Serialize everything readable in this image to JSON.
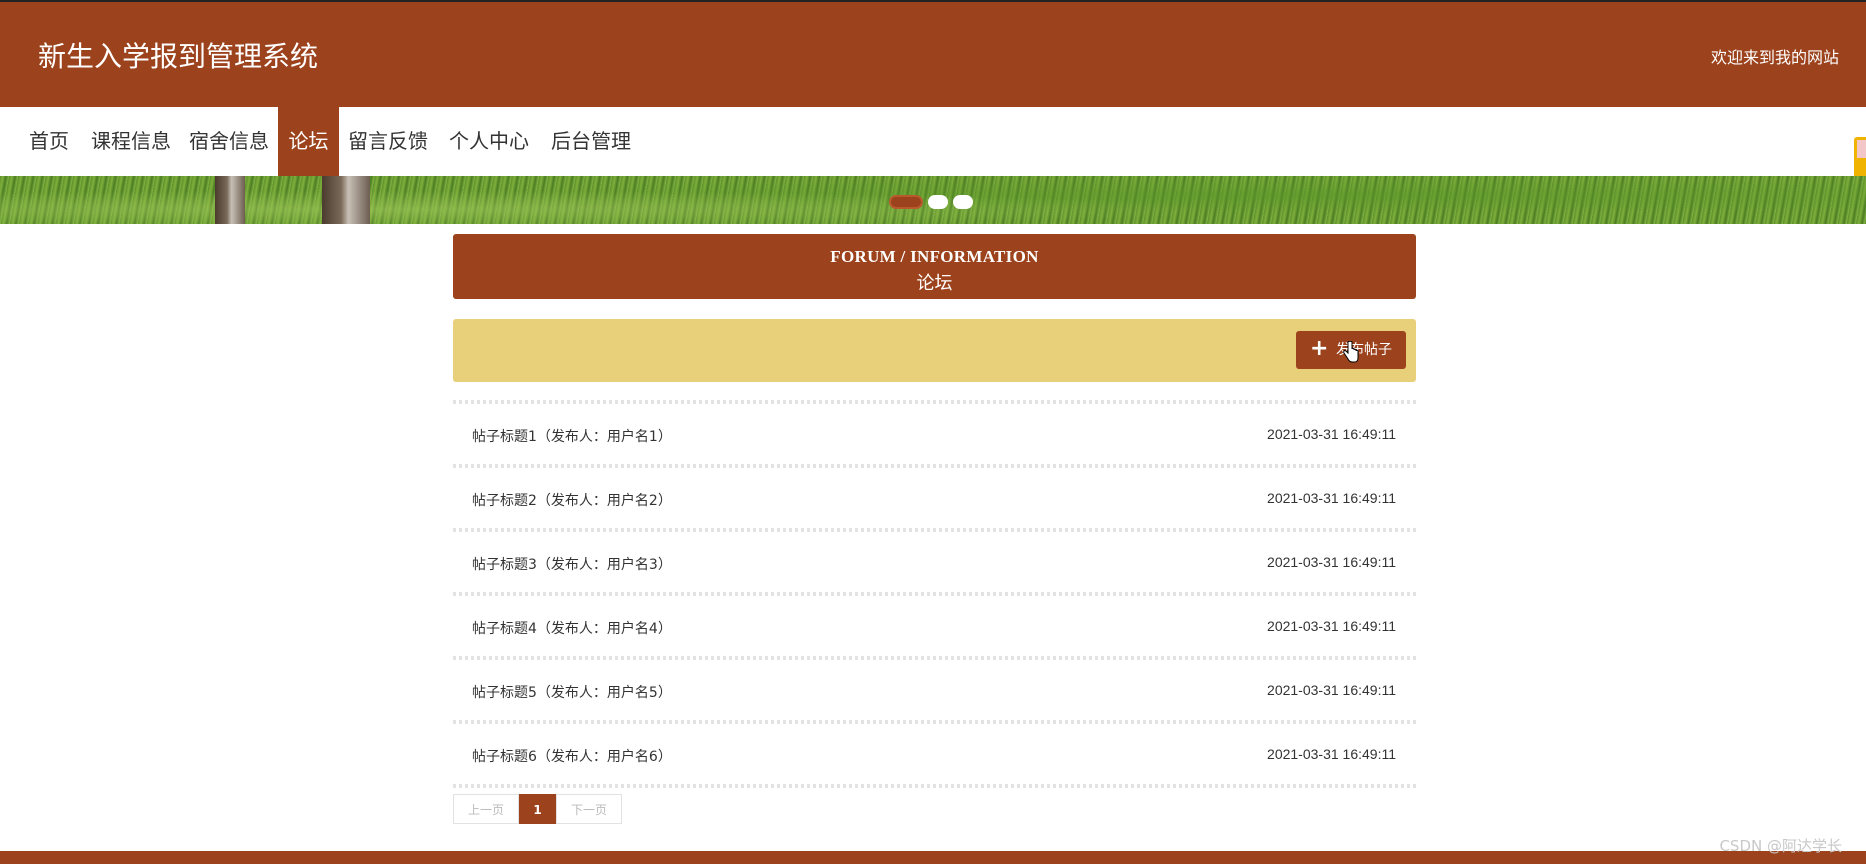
{
  "header": {
    "title": "新生入学报到管理系统",
    "welcome": "欢迎来到我的网站"
  },
  "nav": {
    "items": [
      {
        "label": "首页"
      },
      {
        "label": "课程信息"
      },
      {
        "label": "宿舍信息"
      },
      {
        "label": "论坛",
        "active": true
      },
      {
        "label": "留言反馈"
      },
      {
        "label": "个人中心"
      },
      {
        "label": "后台管理"
      }
    ]
  },
  "banner": {
    "slide_count": 3,
    "active_slide": 1
  },
  "panel": {
    "title_en": "FORUM / INFORMATION",
    "title_cn": "论坛"
  },
  "toolbar": {
    "post_button_label": "发布帖子",
    "post_button_icon": "plus-icon"
  },
  "posts": [
    {
      "title": "帖子标题1（发布人：用户名1）",
      "time": "2021-03-31 16:49:11"
    },
    {
      "title": "帖子标题2（发布人：用户名2）",
      "time": "2021-03-31 16:49:11"
    },
    {
      "title": "帖子标题3（发布人：用户名3）",
      "time": "2021-03-31 16:49:11"
    },
    {
      "title": "帖子标题4（发布人：用户名4）",
      "time": "2021-03-31 16:49:11"
    },
    {
      "title": "帖子标题5（发布人：用户名5）",
      "time": "2021-03-31 16:49:11"
    },
    {
      "title": "帖子标题6（发布人：用户名6）",
      "time": "2021-03-31 16:49:11"
    }
  ],
  "pagination": {
    "prev_label": "上一页",
    "current_page": "1",
    "next_label": "下一页"
  },
  "watermark": "CSDN @阿达学长",
  "colors": {
    "brand": "#9c421c",
    "toolbar_bg": "#e8cf7a"
  }
}
